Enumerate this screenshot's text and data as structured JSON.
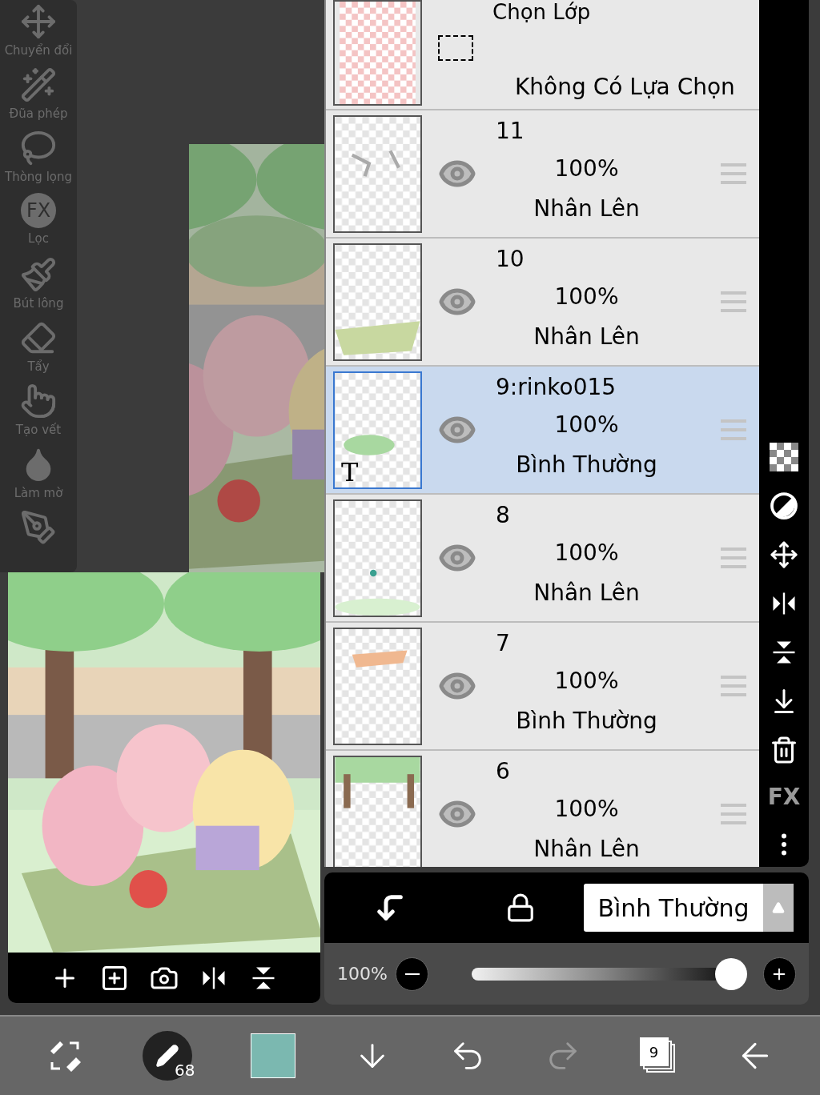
{
  "tool_sidebar": {
    "tools": [
      {
        "kind": "move",
        "label": "Chuyển đổi"
      },
      {
        "kind": "wand",
        "label": "Đũa phép"
      },
      {
        "kind": "lasso",
        "label": "Thòng lọng"
      },
      {
        "kind": "filter",
        "label": "Lọc",
        "icon_text": "FX"
      },
      {
        "kind": "brush",
        "label": "Bút lông"
      },
      {
        "kind": "eraser",
        "label": "Tẩy"
      },
      {
        "kind": "smudge",
        "label": "Tạo vết"
      },
      {
        "kind": "blur",
        "label": "Làm mờ"
      },
      {
        "kind": "special-pen"
      }
    ]
  },
  "layers_panel": {
    "rows": [
      {
        "kind": "selection",
        "title": "Chọn Lớp",
        "status": "Không Có Lựa Chọn"
      },
      {
        "kind": "layer",
        "name": "11",
        "opacity": "100%",
        "blend": "Nhân Lên",
        "visible": true,
        "selected": false
      },
      {
        "kind": "layer",
        "name": "10",
        "opacity": "100%",
        "blend": "Nhân Lên",
        "visible": true,
        "selected": false
      },
      {
        "kind": "layer",
        "name": "9:rinko015",
        "opacity": "100%",
        "blend": "Bình Thường",
        "visible": true,
        "selected": true,
        "thumb_label": "T"
      },
      {
        "kind": "layer",
        "name": "8",
        "opacity": "100%",
        "blend": "Nhân Lên",
        "visible": true,
        "selected": false
      },
      {
        "kind": "layer",
        "name": "7",
        "opacity": "100%",
        "blend": "Bình Thường",
        "visible": true,
        "selected": false
      },
      {
        "kind": "layer",
        "name": "6",
        "opacity": "100%",
        "blend": "Nhân Lên",
        "visible": true,
        "selected": false
      }
    ],
    "toolbar": {
      "fx_label": "FX"
    },
    "blend_mode": {
      "value": "Bình Thường"
    },
    "opacity": {
      "reading": "100%",
      "level": 1.0
    }
  },
  "bottom_toolbar": {
    "brush_size": "68",
    "color_swatch": {
      "color": "#7bb8b0"
    },
    "layer_count": "9"
  }
}
